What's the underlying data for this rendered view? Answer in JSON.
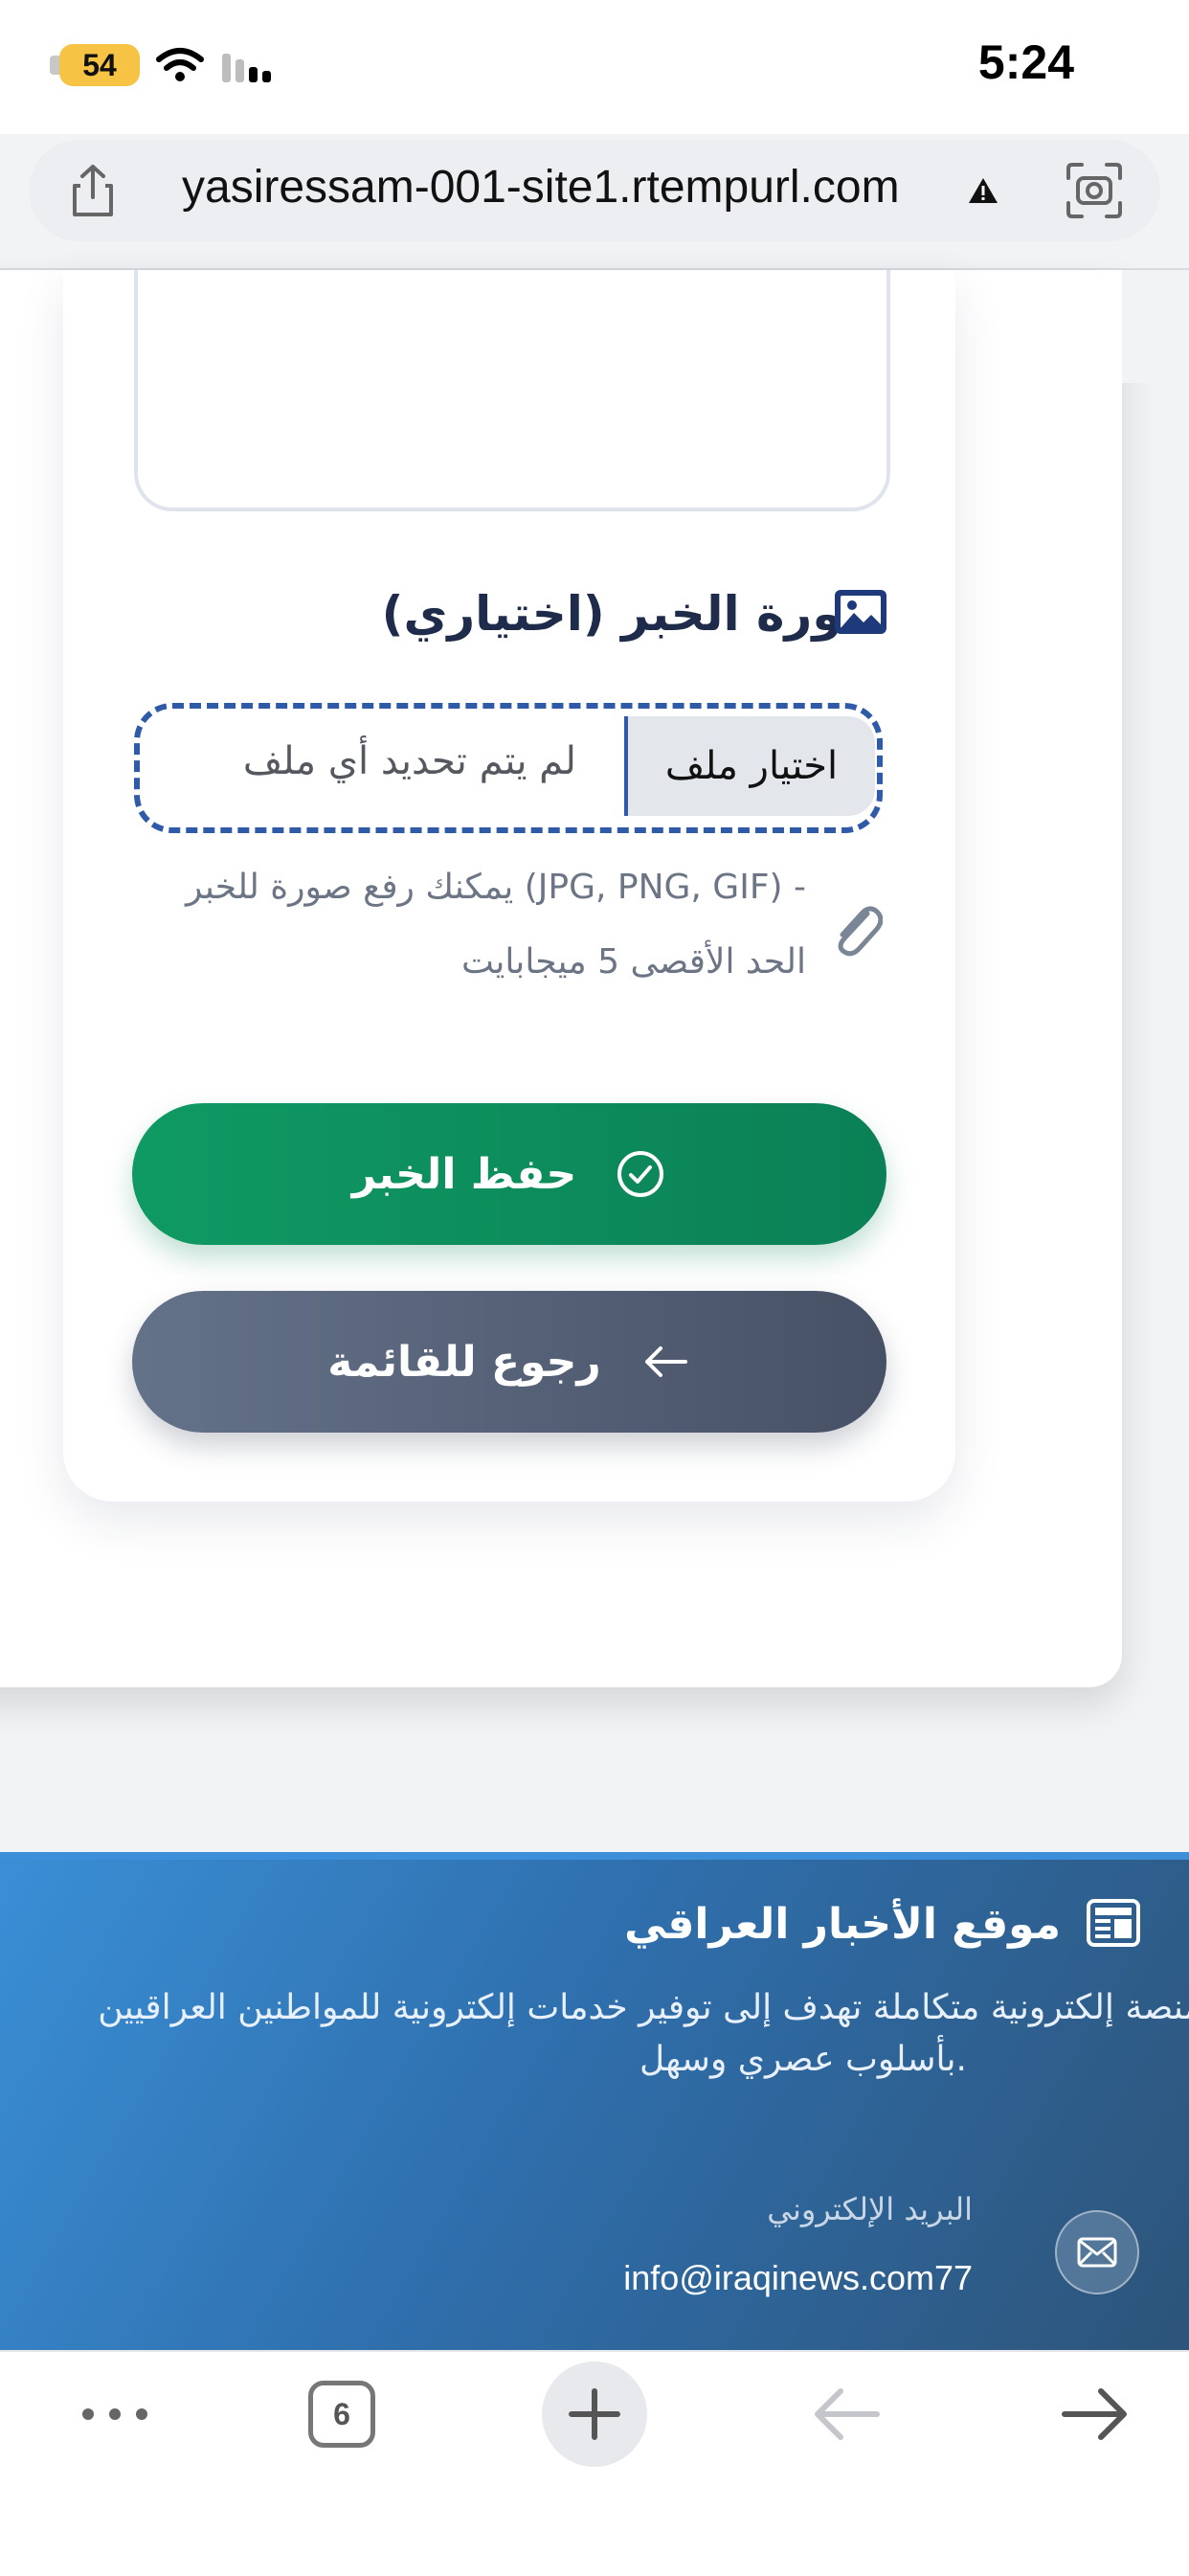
{
  "status_bar": {
    "battery": "54",
    "time": "5:24"
  },
  "browser": {
    "url": "yasiressam-001-site1.rtempurl.com"
  },
  "form": {
    "image_label": "صورة الخبر (اختياري)",
    "choose_file_label": "اختيار ملف",
    "no_file_text": "لم يتم تحديد أي ملف",
    "hint_line1": "يمكنك رفع صورة للخبر (JPG, PNG, GIF) -",
    "hint_line2": "الحد الأقصى 5 ميجابايت",
    "save_button": "حفظ الخبر",
    "back_button": "رجوع للقائمة"
  },
  "footer": {
    "site_title": "موقع الأخبار العراقي",
    "description_line1": "منصة إلكترونية متكاملة تهدف إلى توفير خدمات إلكترونية للمواطنين العراقيين",
    "description_line2": "بأسلوب عصري وسهل.",
    "email_label": "البريد الإلكتروني",
    "email_value": "info@iraqinews.com77"
  },
  "toolbar": {
    "tab_count": "6"
  },
  "colors": {
    "primary_blue": "#2f5aa8",
    "save_green": "#0f9a63",
    "back_slate": "#5a6478",
    "footer_blue": "#2f6fad"
  }
}
